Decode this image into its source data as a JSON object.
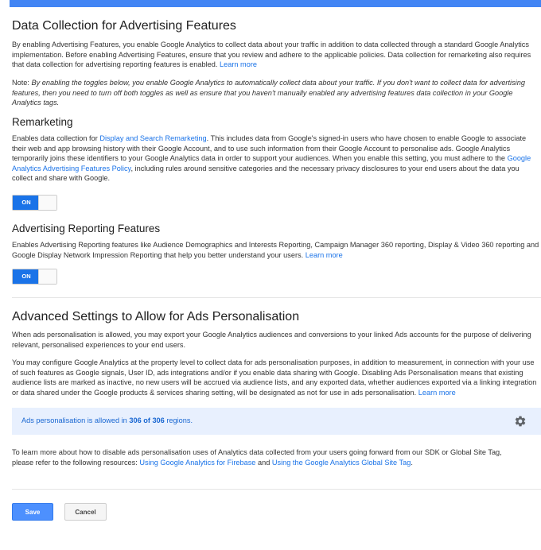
{
  "data_collection": {
    "title": "Data Collection for Advertising Features",
    "description": "By enabling Advertising Features, you enable Google Analytics to collect data about your traffic in addition to data collected through a standard Google Analytics implementation. Before enabling Advertising Features, ensure that you review and adhere to the applicable policies. Data collection for remarketing also requires that data collection for advertising reporting features is enabled.",
    "learn_more": "Learn more",
    "note_label": "Note:",
    "note_text": "By enabling the toggles below, you enable Google Analytics to automatically collect data about your traffic. If you don't want to collect data for advertising features, then you need to turn off both toggles as well as ensure that you haven't manually enabled any advertising features data collection in your Google Analytics tags."
  },
  "remarketing": {
    "title": "Remarketing",
    "text_before_link": "Enables data collection for ",
    "link": "Display and Search Remarketing",
    "text_after_link": ". This includes data from Google's signed-in users who have chosen to enable Google to associate their web and app browsing history with their Google Account, and to use such information from their Google Account to personalise ads. Google Analytics temporarily joins these identifiers to your Google Analytics data in order to support your audiences. When you enable this setting, you must adhere to the",
    "policy_link": "Google Analytics Advertising Features Policy",
    "text_after_policy": ", including rules around sensitive categories and the necessary privacy disclosures to your end users about the data you collect and share with Google.",
    "toggle_label": "ON"
  },
  "reporting": {
    "title": "Advertising Reporting Features",
    "text": "Enables Advertising Reporting features like Audience Demographics and Interests Reporting, Campaign Manager 360 reporting, Display & Video 360 reporting and Google Display Network Impression Reporting that help you better understand your users.",
    "learn_more": "Learn more",
    "toggle_label": "ON"
  },
  "advanced": {
    "title": "Advanced Settings to Allow for Ads Personalisation",
    "para1": "When ads personalisation is allowed, you may export your Google Analytics audiences and conversions to your linked Ads accounts for the purpose of delivering relevant, personalised experiences to your end users.",
    "para2": "You may configure Google Analytics at the property level to collect data for ads personalisation purposes, in addition to measurement, in connection with your use of such features as Google signals, User ID, ads integrations and/or if you enable data sharing with Google. Disabling Ads Personalisation means that existing audience lists are marked as inactive, no new users will be accrued via audience lists, and any exported data, whether audiences exported via a linking integration or data shared under the Google products & services sharing setting, will be designated as not for use in ads personalisation.",
    "learn_more": "Learn more",
    "info_prefix": "Ads personalisation is allowed in ",
    "info_count": "306 of 306",
    "info_suffix": " regions.",
    "para3_before": "To learn more about how to disable ads personalisation uses of Analytics data collected from your users going forward from our SDK or Global Site Tag, please refer to the following resources: ",
    "firebase_link": "Using Google Analytics for Firebase",
    "and": " and ",
    "gtag_link": "Using the Google Analytics Global Site Tag",
    "period": "."
  },
  "actions": {
    "save": "Save",
    "cancel": "Cancel"
  }
}
